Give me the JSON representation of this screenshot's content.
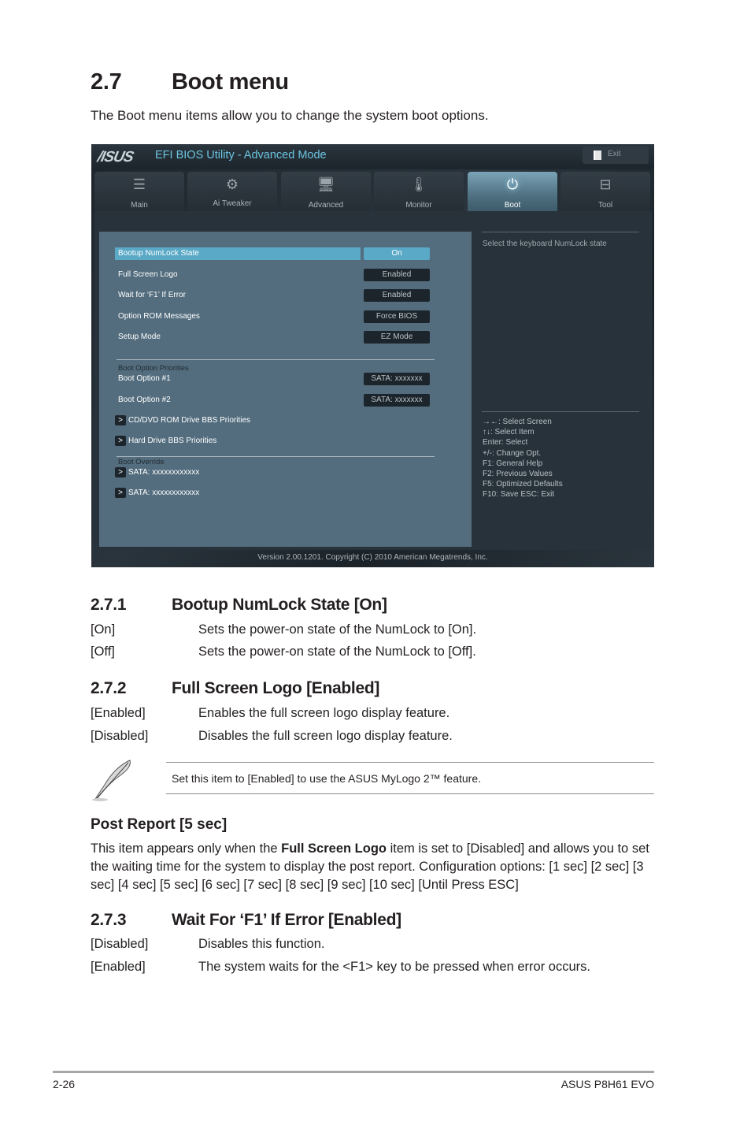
{
  "section": {
    "number": "2.7",
    "title": "Boot menu",
    "intro": "The Boot menu items allow you to change the system boot options."
  },
  "bios": {
    "logo": "/ISUS",
    "title": "EFI BIOS Utility - Advanced Mode",
    "exit_label": "Exit",
    "exit_icon": "exit-door-icon",
    "tabs": [
      {
        "label": "Main",
        "icon": "list-icon",
        "glyph": "☰",
        "active": false
      },
      {
        "label": "Ai  Tweaker",
        "icon": "ai-tweaker-icon",
        "glyph": "⚙",
        "active": false
      },
      {
        "label": "Advanced",
        "icon": "advanced-icon",
        "glyph": "🖥",
        "active": false
      },
      {
        "label": "Monitor",
        "icon": "monitor-thermometer-icon",
        "glyph": "🌡",
        "active": false
      },
      {
        "label": "Boot",
        "icon": "power-icon",
        "glyph": "⏻",
        "active": true
      },
      {
        "label": "Tool",
        "icon": "toolbox-icon",
        "glyph": "⊟",
        "active": false
      }
    ],
    "items": [
      {
        "label": "Bootup NumLock State",
        "value": "On",
        "selected": true
      },
      {
        "label": "Full Screen Logo",
        "value": "Enabled",
        "selected": false
      },
      {
        "label": "Wait for ‘F1’ If Error",
        "value": "Enabled",
        "selected": false
      },
      {
        "label": "Option ROM Messages",
        "value": "Force BIOS",
        "selected": false
      },
      {
        "label": "Setup Mode",
        "value": "EZ Mode",
        "selected": false
      }
    ],
    "boot_priorities_label": "Boot Option Priorities",
    "boot_options": [
      {
        "label": "Boot Option #1",
        "value": "SATA: xxxxxxx"
      },
      {
        "label": "Boot Option #2",
        "value": "SATA: xxxxxxx"
      }
    ],
    "submenus": [
      {
        "label": "CD/DVD ROM Drive BBS Priorities"
      },
      {
        "label": "Hard Drive BBS Priorities"
      }
    ],
    "boot_override_label": "Boot Override",
    "overrides": [
      {
        "label": "SATA: xxxxxxxxxxxx"
      },
      {
        "label": "SATA: xxxxxxxxxxxx"
      }
    ],
    "arrow_glyph": ">",
    "help_text": "Select the keyboard NumLock state",
    "keys": [
      "→←:  Select Screen",
      "↑↓:  Select Item",
      "Enter:  Select",
      "+/-:  Change Opt.",
      "F1:  General Help",
      "F2:  Previous Values",
      "F5:  Optimized Defaults",
      "F10:  Save    ESC:  Exit"
    ],
    "footer": "Version  2.00.1201.  Copyright  (C)  2010  American  Megatrends,  Inc."
  },
  "sub_sections": [
    {
      "number": "2.7.1",
      "title": "Bootup NumLock State [On]",
      "options": [
        {
          "key": "[On]",
          "desc": "Sets the power-on state of the NumLock to [On]."
        },
        {
          "key": "[Off]",
          "desc": "Sets the power-on state of the NumLock to [Off]."
        }
      ]
    },
    {
      "number": "2.7.2",
      "title": "Full Screen Logo [Enabled]",
      "options": [
        {
          "key": "[Enabled]",
          "desc": "Enables the full screen logo display feature."
        },
        {
          "key": "[Disabled]",
          "desc": "Disables the full screen logo display feature."
        }
      ]
    },
    {
      "number": "2.7.3",
      "title": "Wait For ‘F1’ If Error [Enabled]",
      "options": [
        {
          "key": "[Disabled]",
          "desc": "Disables this function."
        },
        {
          "key": "[Enabled]",
          "desc": "The system waits for the <F1> key to be pressed when error occurs."
        }
      ]
    }
  ],
  "note": {
    "icon": "feather-pen-icon",
    "text": "Set this item to [Enabled] to use the ASUS MyLogo 2™ feature."
  },
  "post_report": {
    "title": "Post Report [5 sec]",
    "text_before": "This item appears only when the ",
    "text_bold": "Full Screen Logo",
    "text_after": " item is set to [Disabled] and allows you to set the waiting time for the system to display the post report. Configuration options: [1 sec] [2 sec] [3 sec] [4 sec] [5 sec] [6 sec] [7 sec] [8 sec] [9 sec] [10 sec] [Until Press ESC]"
  },
  "footer": {
    "page": "2-26",
    "product": "ASUS P8H61 EVO"
  },
  "colors": {
    "accent": "#5aa9c7",
    "title_cyan": "#6cc4e0",
    "panel": "#536d7e",
    "value_bg": "#1d252c"
  }
}
